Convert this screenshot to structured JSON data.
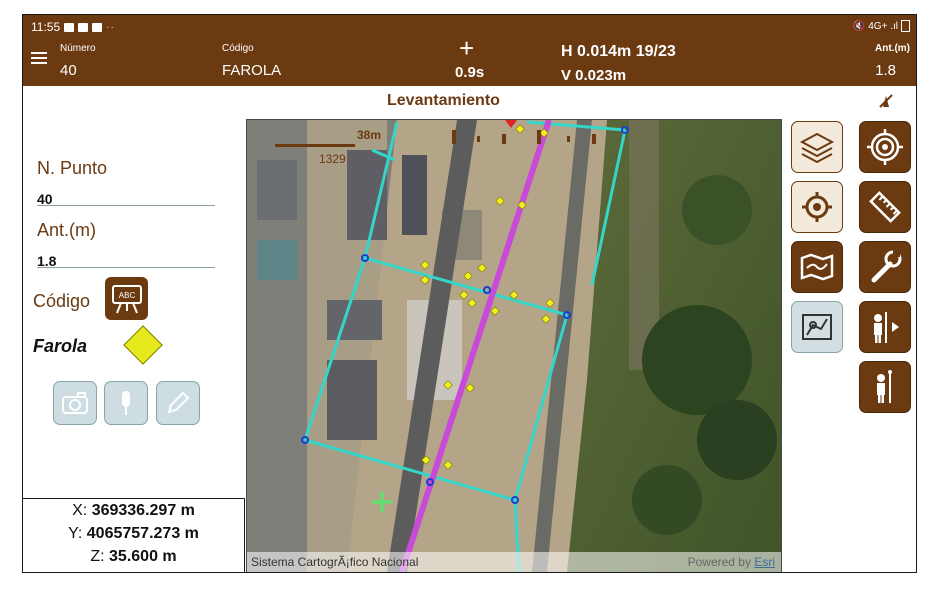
{
  "status_bar": {
    "time": "11:55",
    "dots": "··",
    "right": "4G+ .ıl"
  },
  "header": {
    "numero_label": "Número",
    "numero_value": "40",
    "codigo_label": "Código",
    "codigo_value": "FAROLA",
    "time_value": "0.9s",
    "h_precision": "H 0.014m 19/23",
    "v_precision": "V 0.023m",
    "antenna_label": "Ant.(m)",
    "antenna_value": "1.8"
  },
  "title": "Levantamiento",
  "left_panel": {
    "point_label": "N. Punto",
    "point_value": "40",
    "antenna_label": "Ant.(m)",
    "antenna_value": "1.8",
    "code_label": "Código",
    "code_button_text": "ABC",
    "code_name": "Farola",
    "code_color": "#e6ea1c"
  },
  "coords": {
    "x_label": "X:",
    "x_value": "369336.297 m",
    "y_label": "Y:",
    "y_value": "4065757.273 m",
    "z_label": "Z:",
    "z_value": "35.600 m"
  },
  "map": {
    "scale_label": "38m",
    "scale_sub": "1329",
    "attribution": "Sistema CartogrÃ¡fico Nacional",
    "powered_by": "Powered by",
    "powered_by_brand": "Esri"
  },
  "colors": {
    "brand": "#6b3a11",
    "line_cyan": "#33d6c8",
    "line_magenta": "#c84ad8",
    "point_yellow": "#f3ee1d"
  }
}
